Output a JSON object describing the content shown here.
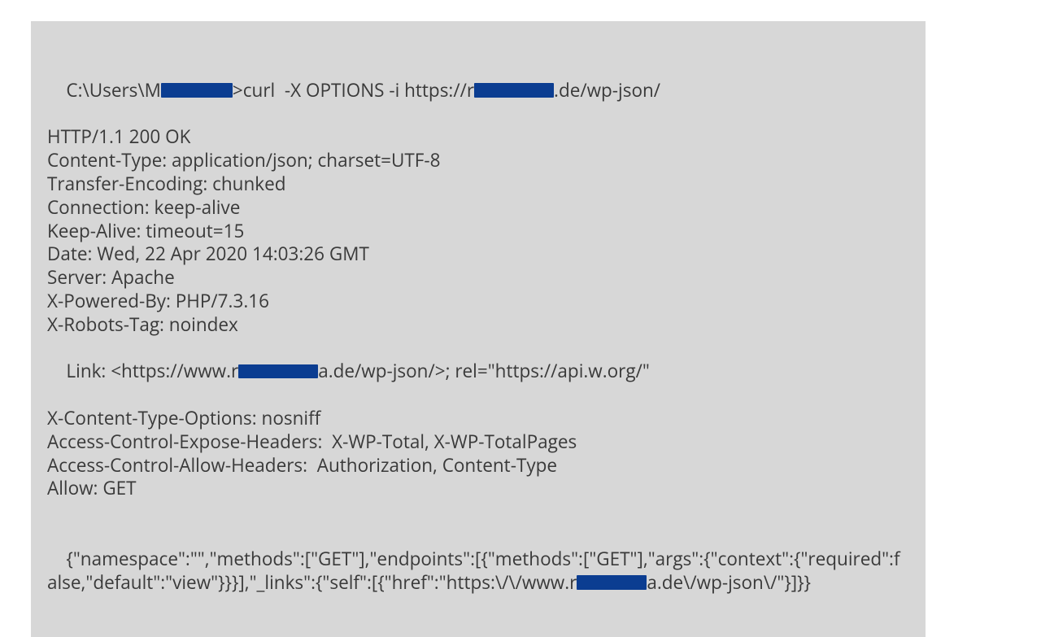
{
  "cmd": {
    "prefix": "C:\\Users\\",
    "redacted_pre_char": "M",
    "after_redact": ">curl  -X OPTIONS -i https://",
    "redacted2_pre_char": "r",
    "suffix": ".de/wp-json/"
  },
  "headers": {
    "status": "HTTP/1.1 200 OK",
    "content_type": "Content-Type: application/json; charset=UTF-8",
    "transfer_encoding": "Transfer-Encoding: chunked",
    "connection": "Connection: keep-alive",
    "keep_alive": "Keep-Alive: timeout=15",
    "date": "Date: Wed, 22 Apr 2020 14:03:26 GMT",
    "server": "Server: Apache",
    "x_powered_by": "X-Powered-By: PHP/7.3.16",
    "x_robots": "X-Robots-Tag: noindex",
    "link_prefix": "Link: <https://www.",
    "link_pre_char": "r",
    "link_post_char": "a",
    "link_suffix": ".de/wp-json/>; rel=\"https://api.w.org/\"",
    "x_content_type_options": "X-Content-Type-Options: nosniff",
    "ac_expose": "Access-Control-Expose-Headers:  X-WP-Total, X-WP-TotalPages",
    "ac_allow": "Access-Control-Allow-Headers:  Authorization, Content-Type",
    "allow": "Allow: GET"
  },
  "body": {
    "part1": "{\"namespace\":\"\",\"methods\":[\"GET\"],\"endpoints\":[{\"methods\":[\"GET\"],\"args\":{\"context\":{\"required\":false,\"default\":\"view\"}}}],\"_links\":{\"self\":[{\"href\":\"https:\\/\\/www.",
    "pre_char": "r",
    "post_char": "a",
    "part2": ".de\\/wp-json\\/\"}]}}"
  }
}
